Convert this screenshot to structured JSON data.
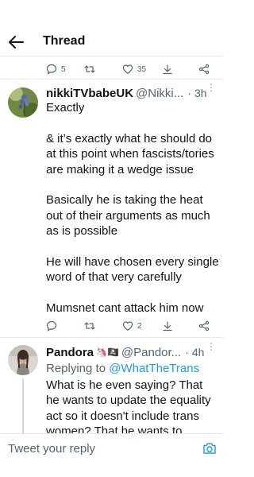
{
  "header": {
    "title": "Thread"
  },
  "prev_tweet_actions": {
    "replies": "5",
    "retweets": "",
    "likes": "35"
  },
  "tweet1": {
    "display_name": "nikkiTVbabeUK",
    "handle": "@Nikki...",
    "time": "3h",
    "paragraphs": [
      "Exactly",
      "& it’s exactly what he should do at this point when fascists/tories are making it a wedge issue",
      "Basically he is taking the heat out of their arguments as much as is possible",
      "He will have chosen every single word of that very carefully",
      "Mumsnet cant attack him now"
    ],
    "actions": {
      "replies": "",
      "retweets": "",
      "likes": "2"
    }
  },
  "tweet2": {
    "display_name": "Pandora",
    "name_emojis": "🦄🏴‍☠️",
    "handle": "@Pandor...",
    "time": "4h",
    "replying_prefix": "Replying to",
    "replying_handle": "@WhatTheTrans",
    "text": "What is he even saying? That he wants to update the equality act so it doesn't include trans women? That he wants to"
  },
  "composer": {
    "placeholder": "Tweet your reply"
  },
  "icons": {
    "back": "arrow-left-icon",
    "reply": "reply-bubble-icon",
    "retweet": "retweet-icon",
    "like": "heart-icon",
    "download": "download-icon",
    "share": "share-icon",
    "more": "more-vertical-icon",
    "camera": "camera-icon"
  },
  "colors": {
    "accent": "#1d9bf0",
    "secondary_text": "#536471",
    "divider": "#e6ecf0"
  }
}
